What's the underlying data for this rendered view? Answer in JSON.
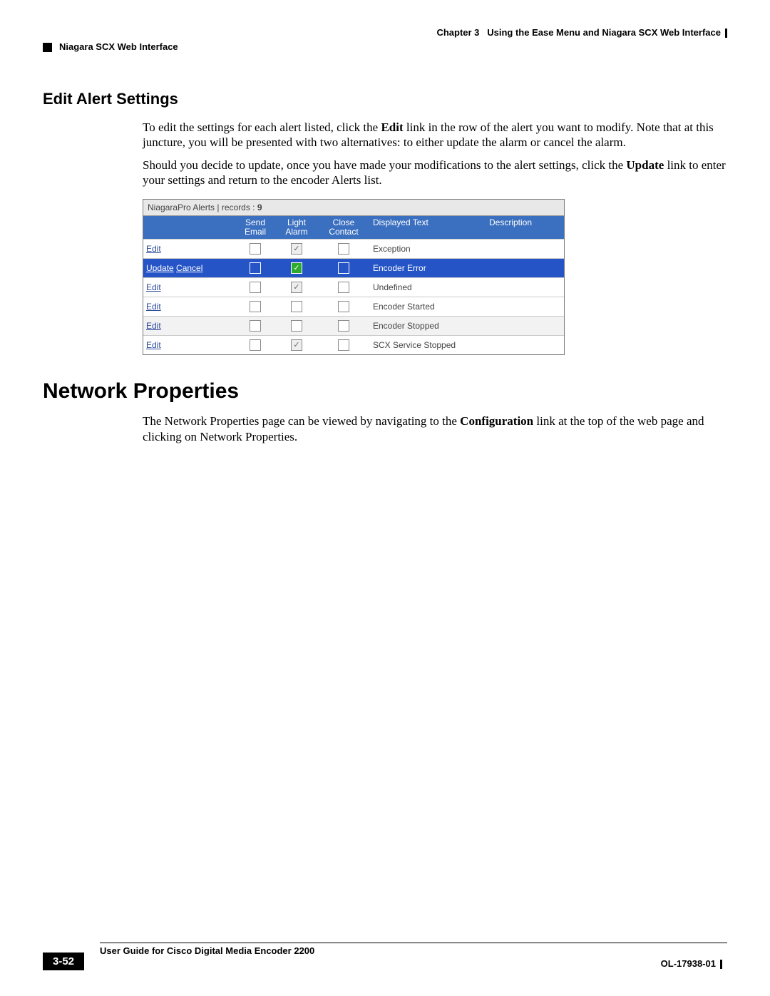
{
  "header": {
    "chapter": "Chapter 3",
    "chapter_title": "Using the Ease Menu and Niagara SCX Web Interface",
    "section": "Niagara SCX Web Interface"
  },
  "section1": {
    "heading": "Edit Alert Settings",
    "para1_a": "To edit the settings for each alert listed, click the ",
    "para1_b": "Edit",
    "para1_c": " link in the row of the alert you want to modify. Note that at this juncture, you will be presented with two alternatives: to either update the alarm or cancel the alarm.",
    "para2_a": "Should you decide to update, once you have made your modifications to the alert settings, click the ",
    "para2_b": "Update",
    "para2_c": " link to enter your settings and return to the encoder Alerts list."
  },
  "table": {
    "title_prefix": "NiagaraPro Alerts | records : ",
    "record_count": "9",
    "columns": {
      "send_top": "Send",
      "send_bot": "Email",
      "light_top": "Light",
      "light_bot": "Alarm",
      "close_top": "Close",
      "close_bot": "Contact",
      "displayed": "Displayed Text",
      "description": "Description"
    },
    "rows": [
      {
        "action1": "Edit",
        "action2": "",
        "send": false,
        "light": true,
        "light_disabled": true,
        "close": false,
        "text": "Exception",
        "selected": false,
        "alt": false
      },
      {
        "action1": "Update",
        "action2": "Cancel",
        "send": false,
        "light": true,
        "light_disabled": false,
        "close": false,
        "text": "Encoder Error",
        "selected": true,
        "alt": false
      },
      {
        "action1": "Edit",
        "action2": "",
        "send": false,
        "light": true,
        "light_disabled": true,
        "close": false,
        "text": "Undefined",
        "selected": false,
        "alt": false
      },
      {
        "action1": "Edit",
        "action2": "",
        "send": false,
        "light": false,
        "light_disabled": false,
        "close": false,
        "text": "Encoder Started",
        "selected": false,
        "alt": false
      },
      {
        "action1": "Edit",
        "action2": "",
        "send": false,
        "light": false,
        "light_disabled": false,
        "close": false,
        "text": "Encoder Stopped",
        "selected": false,
        "alt": true
      },
      {
        "action1": "Edit",
        "action2": "",
        "send": false,
        "light": true,
        "light_disabled": true,
        "close": false,
        "text": "SCX Service Stopped",
        "selected": false,
        "alt": false
      }
    ]
  },
  "section2": {
    "heading": "Network Properties",
    "para_a": "The Network Properties page can be viewed by navigating to the ",
    "para_b": "Configuration",
    "para_c": " link at the top of the web page and clicking on Network Properties."
  },
  "footer": {
    "guide": "User Guide for Cisco Digital Media Encoder 2200",
    "page": "3-52",
    "docnum": "OL-17938-01"
  }
}
